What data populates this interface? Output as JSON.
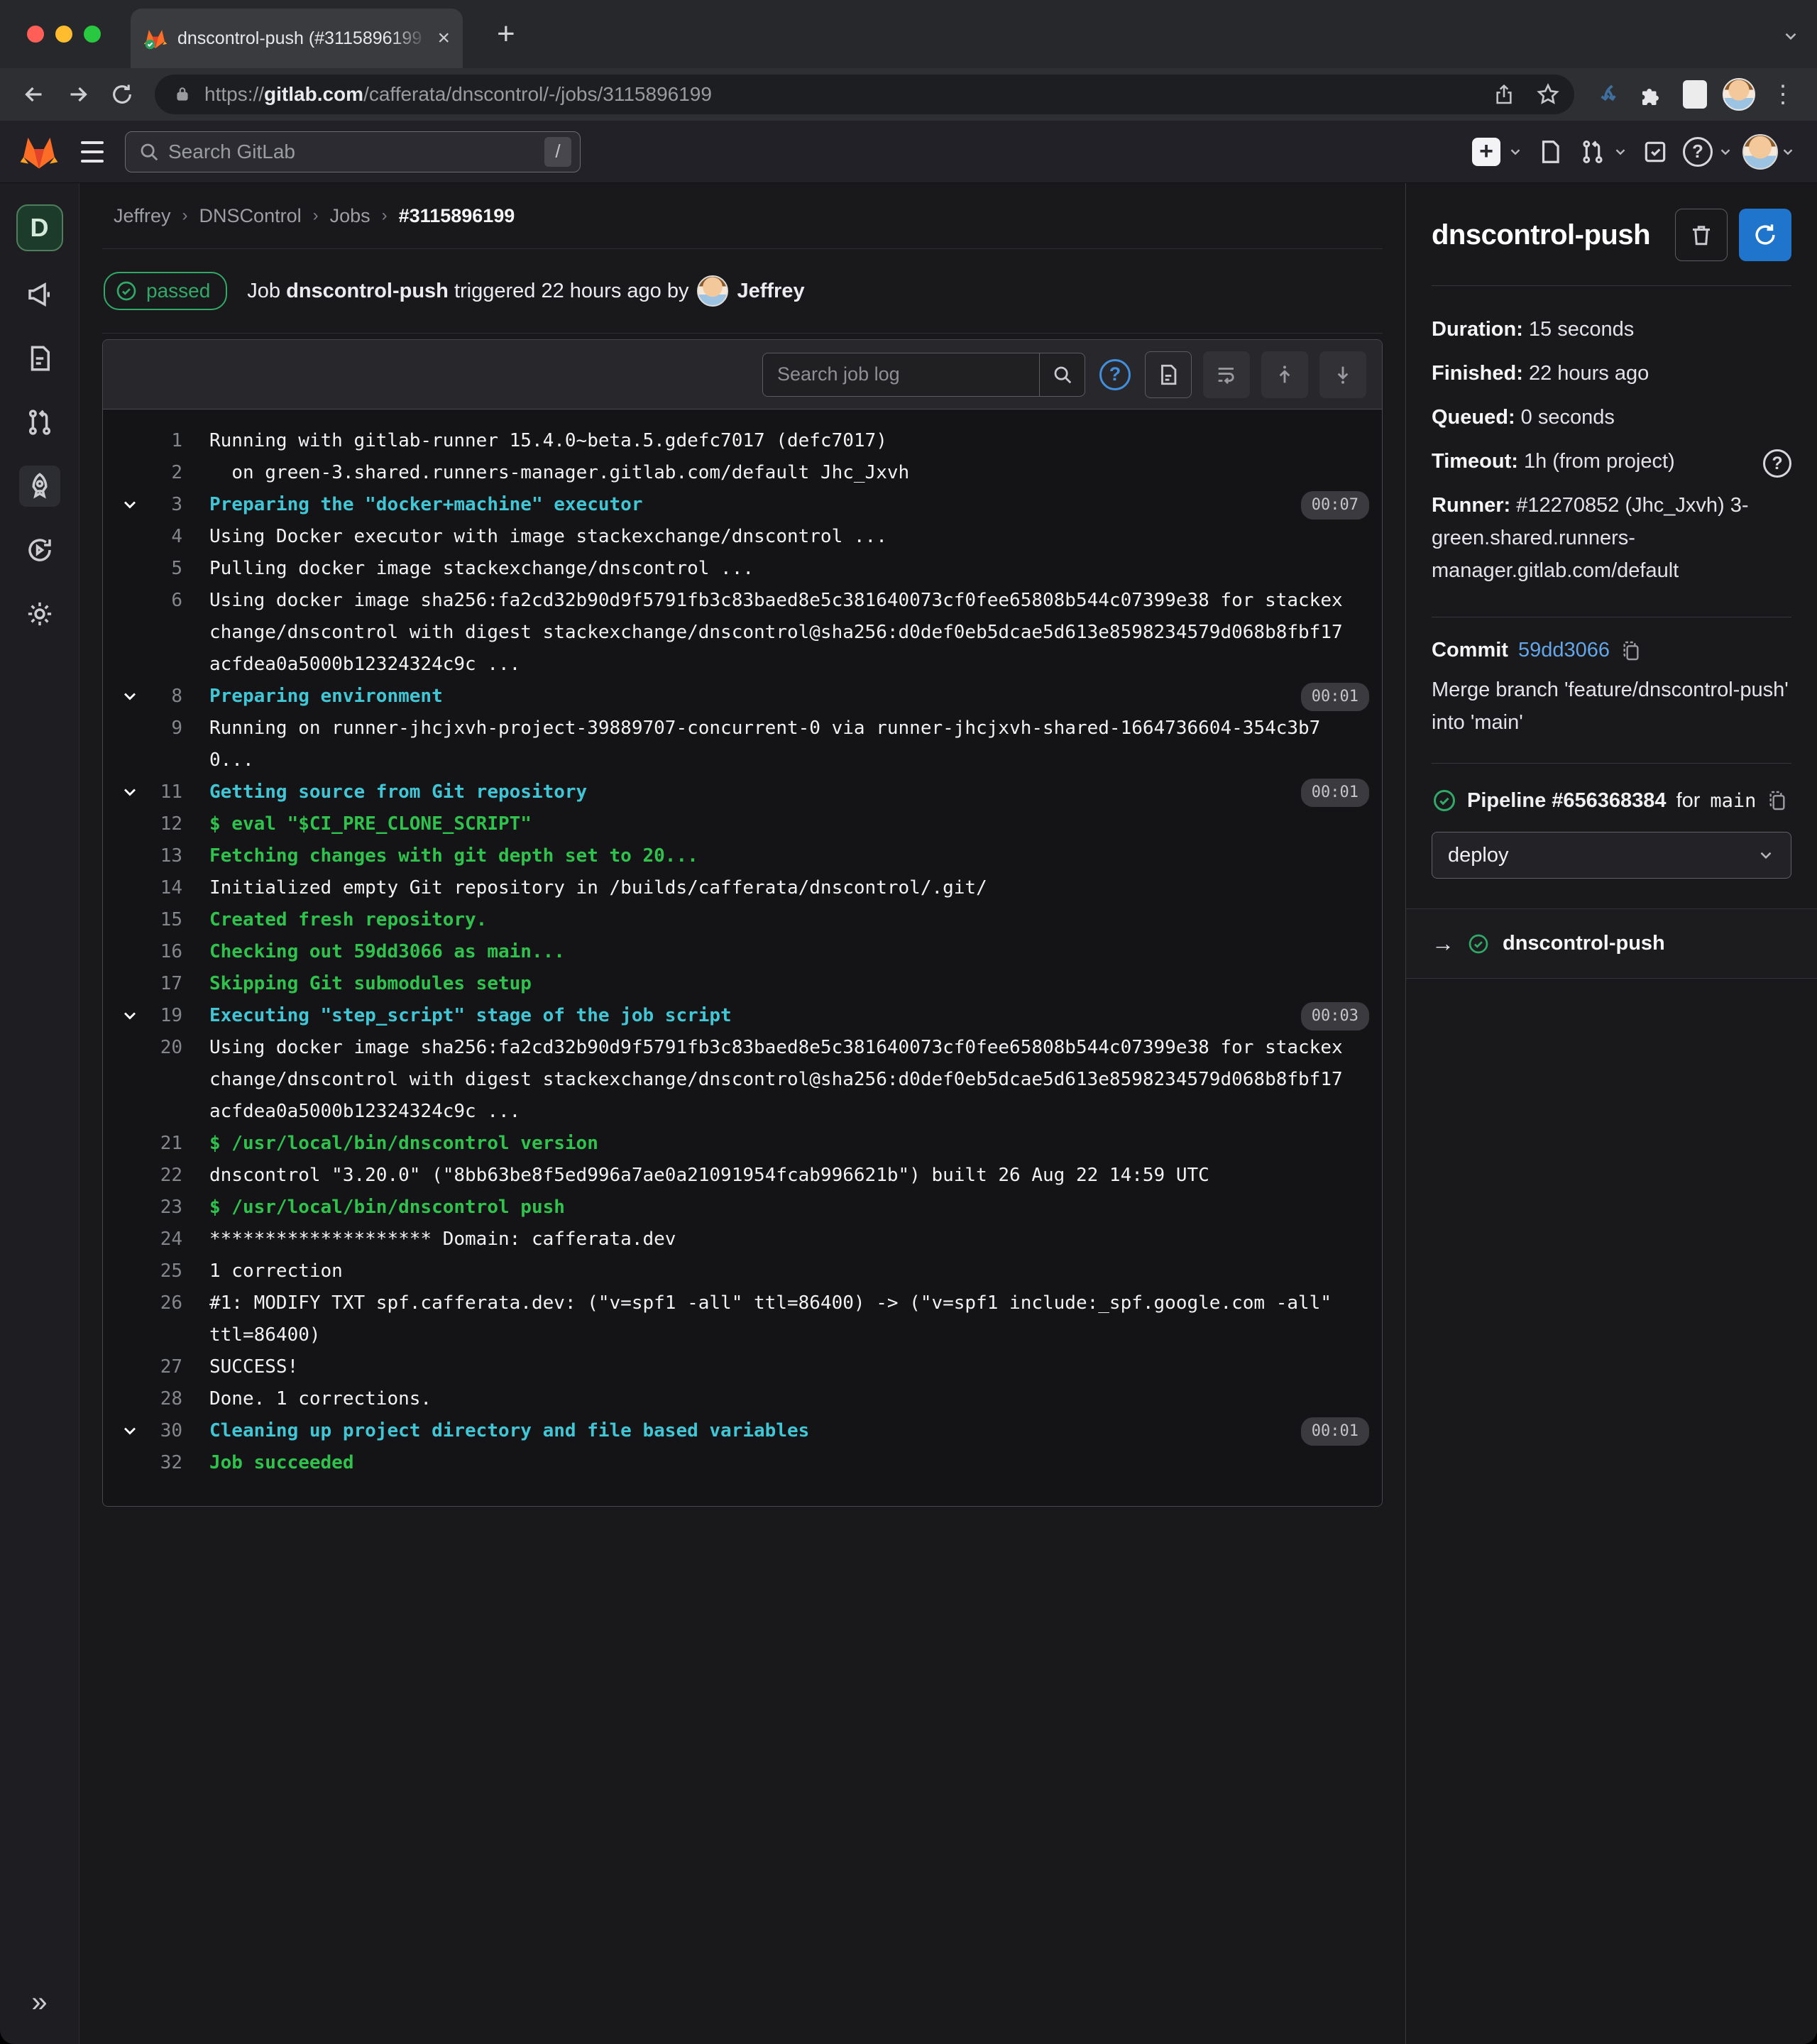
{
  "colors": {
    "accent_blue": "#1f75cb",
    "link_blue": "#63a6e9",
    "help_blue": "#428fdc",
    "success_green": "#31a968",
    "log_green": "#2fc24d",
    "log_cyan": "#41c6d6",
    "brand_orange": "#fc6d26",
    "brand_red": "#e24329",
    "brand_yellow": "#fca326",
    "log_bg": "#141416",
    "page_bg": "#19191b"
  },
  "browser": {
    "tab_title": "dnscontrol-push (#3115896199",
    "url_scheme": "https://",
    "url_host": "gitlab.com",
    "url_path": "/cafferata/dnscontrol/-/jobs/3115896199"
  },
  "navbar": {
    "search_placeholder": "Search GitLab",
    "search_kbd": "/"
  },
  "rail": {
    "project_initial": "D",
    "collapse_glyph": "»"
  },
  "breadcrumb": {
    "separator": "›",
    "items": [
      {
        "label": "Jeffrey"
      },
      {
        "label": "DNSControl"
      },
      {
        "label": "Jobs"
      },
      {
        "label": "#3115896199"
      }
    ]
  },
  "status": {
    "badge": "passed",
    "prefix": "Job",
    "job_name": "dnscontrol-push",
    "middle": "triggered 22 hours ago by",
    "user": "Jeffrey"
  },
  "log": {
    "search_placeholder": "Search job log",
    "lines": [
      {
        "n": 1,
        "kind": "default",
        "text": "Running with gitlab-runner 15.4.0~beta.5.gdefc7017 (defc7017)"
      },
      {
        "n": 2,
        "kind": "default",
        "text": "  on green-3.shared.runners-manager.gitlab.com/default Jhc_Jxvh"
      },
      {
        "n": 3,
        "kind": "section",
        "text": "Preparing the \"docker+machine\" executor",
        "duration": "00:07"
      },
      {
        "n": 4,
        "kind": "default",
        "text": "Using Docker executor with image stackexchange/dnscontrol ..."
      },
      {
        "n": 5,
        "kind": "default",
        "text": "Pulling docker image stackexchange/dnscontrol ..."
      },
      {
        "n": 6,
        "kind": "default",
        "text": "Using docker image sha256:fa2cd32b90d9f5791fb3c83baed8e5c381640073cf0fee65808b544c07399e38 for stackexchange/dnscontrol with digest stackexchange/dnscontrol@sha256:d0def0eb5dcae5d613e8598234579d068b8fbf17acfdea0a5000b12324324c9c ..."
      },
      {
        "n": 8,
        "kind": "section",
        "text": "Preparing environment",
        "duration": "00:01"
      },
      {
        "n": 9,
        "kind": "default",
        "text": "Running on runner-jhcjxvh-project-39889707-concurrent-0 via runner-jhcjxvh-shared-1664736604-354c3b70..."
      },
      {
        "n": 11,
        "kind": "section",
        "text": "Getting source from Git repository",
        "duration": "00:01"
      },
      {
        "n": 12,
        "kind": "green",
        "text": "$ eval \"$CI_PRE_CLONE_SCRIPT\""
      },
      {
        "n": 13,
        "kind": "green",
        "text": "Fetching changes with git depth set to 20..."
      },
      {
        "n": 14,
        "kind": "default",
        "text": "Initialized empty Git repository in /builds/cafferata/dnscontrol/.git/"
      },
      {
        "n": 15,
        "kind": "green",
        "text": "Created fresh repository."
      },
      {
        "n": 16,
        "kind": "green",
        "text": "Checking out 59dd3066 as main..."
      },
      {
        "n": 17,
        "kind": "green",
        "text": "Skipping Git submodules setup"
      },
      {
        "n": 19,
        "kind": "section",
        "text": "Executing \"step_script\" stage of the job script",
        "duration": "00:03"
      },
      {
        "n": 20,
        "kind": "default",
        "text": "Using docker image sha256:fa2cd32b90d9f5791fb3c83baed8e5c381640073cf0fee65808b544c07399e38 for stackexchange/dnscontrol with digest stackexchange/dnscontrol@sha256:d0def0eb5dcae5d613e8598234579d068b8fbf17acfdea0a5000b12324324c9c ..."
      },
      {
        "n": 21,
        "kind": "green",
        "text": "$ /usr/local/bin/dnscontrol version"
      },
      {
        "n": 22,
        "kind": "default",
        "text": "dnscontrol \"3.20.0\" (\"8bb63be8f5ed996a7ae0a21091954fcab996621b\") built 26 Aug 22 14:59 UTC"
      },
      {
        "n": 23,
        "kind": "green",
        "text": "$ /usr/local/bin/dnscontrol push"
      },
      {
        "n": 24,
        "kind": "default",
        "text": "******************** Domain: cafferata.dev"
      },
      {
        "n": 25,
        "kind": "default",
        "text": "1 correction"
      },
      {
        "n": 26,
        "kind": "default",
        "text": "#1: MODIFY TXT spf.cafferata.dev: (\"v=spf1 -all\" ttl=86400) -> (\"v=spf1 include:_spf.google.com -all\" ttl=86400)"
      },
      {
        "n": 27,
        "kind": "default",
        "text": "SUCCESS!"
      },
      {
        "n": 28,
        "kind": "default",
        "text": "Done. 1 corrections."
      },
      {
        "n": 30,
        "kind": "section",
        "text": "Cleaning up project directory and file based variables",
        "duration": "00:01"
      },
      {
        "n": 32,
        "kind": "green",
        "text": "Job succeeded"
      }
    ]
  },
  "sidebar": {
    "title": "dnscontrol-push",
    "details": [
      {
        "label": "Duration:",
        "value": "15 seconds"
      },
      {
        "label": "Finished:",
        "value": "22 hours ago"
      },
      {
        "label": "Queued:",
        "value": "0 seconds"
      },
      {
        "label": "Timeout:",
        "value": "1h (from project)",
        "help": true
      },
      {
        "label": "Runner:",
        "value": "#12270852 (Jhc_Jxvh) 3-green.shared.runners-manager.gitlab.com/default"
      }
    ],
    "commit": {
      "label": "Commit",
      "sha": "59dd3066",
      "message": "Merge branch 'feature/dnscontrol-push' into 'main'"
    },
    "pipeline": {
      "prefix": "Pipeline",
      "id": "#656368384",
      "for_word": "for",
      "ref": "main"
    },
    "stage_select": {
      "value": "deploy"
    },
    "related_job": {
      "arrow": "→",
      "name": "dnscontrol-push"
    }
  }
}
